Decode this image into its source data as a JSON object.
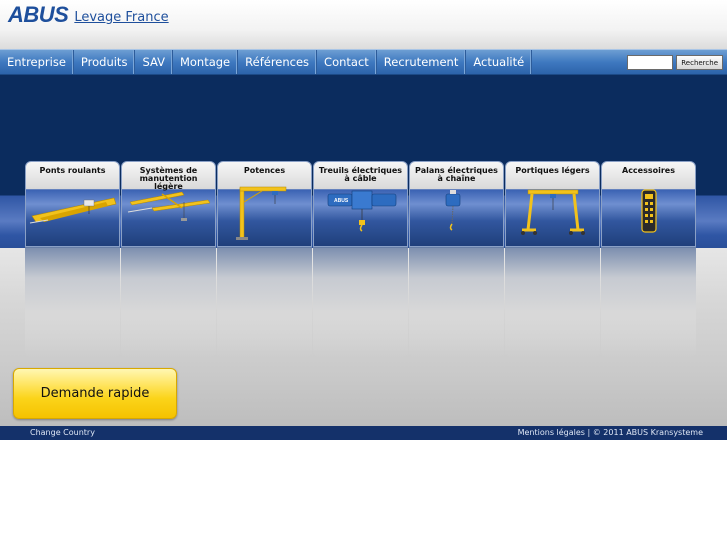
{
  "header": {
    "logo_mark": "ABUS",
    "logo_sub": "Levage France"
  },
  "nav": {
    "items": [
      "Entreprise",
      "Produits",
      "SAV",
      "Montage",
      "Références",
      "Contact",
      "Recrutement",
      "Actualité"
    ],
    "search_value": "",
    "search_button": "Recherche"
  },
  "products": [
    {
      "label": "Ponts roulants",
      "icon": "overhead-crane-icon"
    },
    {
      "label": "Systèmes de manutention légère",
      "icon": "light-handling-system-icon"
    },
    {
      "label": "Potences",
      "icon": "jib-crane-icon"
    },
    {
      "label": "Treuils électriques à câble",
      "icon": "wire-rope-hoist-icon"
    },
    {
      "label": "Palans électriques à chaîne",
      "icon": "chain-hoist-icon"
    },
    {
      "label": "Portiques légers",
      "icon": "light-gantry-icon"
    },
    {
      "label": "Accessoires",
      "icon": "remote-control-icon"
    }
  ],
  "quick_request": "Demande rapide",
  "footer": {
    "change_country": "Change Country",
    "legal": "Mentions légales",
    "separator": " | ",
    "copyright": "© 2011 ABUS Kransysteme"
  },
  "colors": {
    "brand_blue": "#1e4f9c",
    "nav_blue": "#3f79c0",
    "dark_navy": "#0b2c5e",
    "footer_navy": "#14316a",
    "crane_yellow": "#f2c21c",
    "button_yellow": "#fbd41a"
  }
}
